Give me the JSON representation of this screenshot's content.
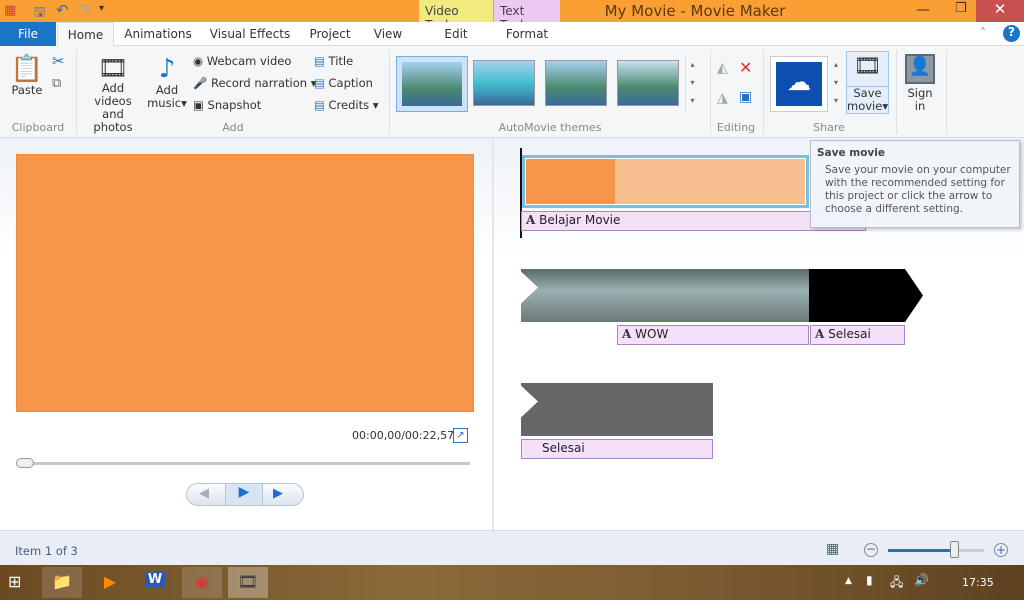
{
  "window": {
    "title": "My Movie - Movie Maker",
    "context_video": "Video Tools",
    "context_text": "Text Tools"
  },
  "tabs": [
    "File",
    "Home",
    "Animations",
    "Visual Effects",
    "Project",
    "View",
    "Edit",
    "Format"
  ],
  "ribbon": {
    "clipboard": {
      "paste": "Paste",
      "group": "Clipboard"
    },
    "add": {
      "add_videos_1": "Add videos",
      "add_videos_2": "and photos",
      "add_music_1": "Add",
      "add_music_2": "music",
      "webcam": "Webcam video",
      "narration": "Record narration",
      "snapshot": "Snapshot",
      "title": "Title",
      "caption": "Caption",
      "credits": "Credits",
      "group": "Add"
    },
    "themes": {
      "group": "AutoMovie themes"
    },
    "editing": {
      "group": "Editing"
    },
    "share": {
      "save_1": "Save",
      "save_2": "movie",
      "group": "Share"
    },
    "signin": {
      "l1": "Sign",
      "l2": "in"
    }
  },
  "preview": {
    "color": "#f7964a",
    "timecode": "00:00,00/00:22,57",
    "seek_fraction": 0
  },
  "storyboard": {
    "clip1_caption": "Belajar Movie",
    "clip2_caption1": "WOW",
    "clip2_caption2": "Selesai",
    "clip3_caption": "Selesai"
  },
  "tooltip": {
    "title": "Save movie",
    "body": "Save your movie on your computer with the recommended setting for this project or click the arrow to choose a different setting."
  },
  "status": {
    "item": "Item 1 of 3",
    "zoom_fraction": 0.68
  },
  "taskbar": {
    "clock": "17:35"
  }
}
